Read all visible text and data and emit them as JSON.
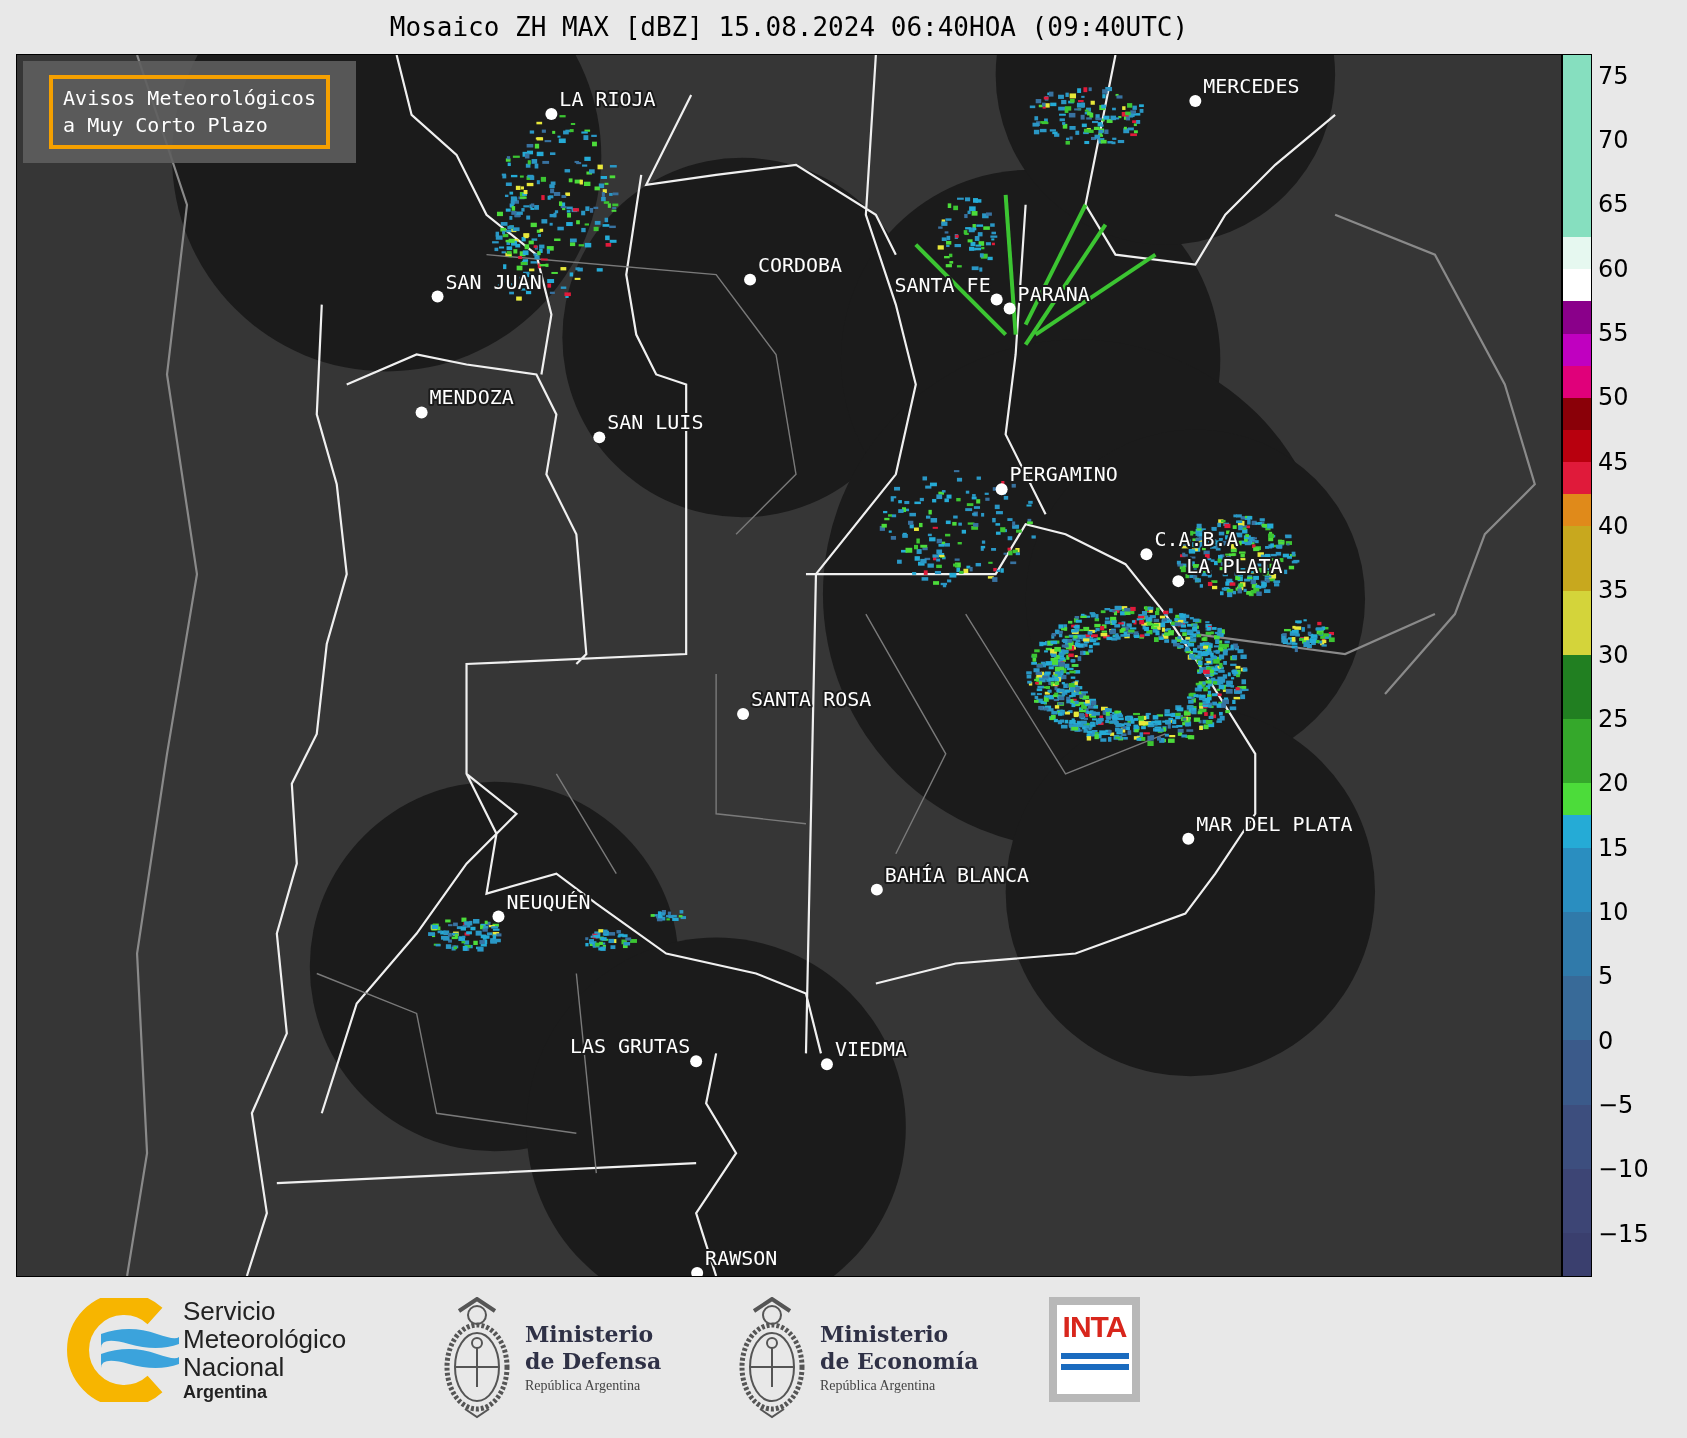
{
  "title": "Mosaico ZH MAX [dBZ] 15.08.2024 06:40HOA (09:40UTC)",
  "notice": [
    "Avisos Meteorológicos",
    "a Muy Corto Plazo"
  ],
  "cities": [
    {
      "name": "LA RIOJA"
    },
    {
      "name": "MERCEDES"
    },
    {
      "name": "SAN JUAN"
    },
    {
      "name": "CORDOBA"
    },
    {
      "name": "SANTA FE"
    },
    {
      "name": "PARANA"
    },
    {
      "name": "MENDOZA"
    },
    {
      "name": "SAN LUIS"
    },
    {
      "name": "PERGAMINO"
    },
    {
      "name": "C.A.B.A"
    },
    {
      "name": "LA PLATA"
    },
    {
      "name": "SANTA ROSA"
    },
    {
      "name": "MAR DEL PLATA"
    },
    {
      "name": "BAHÍA BLANCA"
    },
    {
      "name": "NEUQUÉN"
    },
    {
      "name": "LAS GRUTAS"
    },
    {
      "name": "VIEDMA"
    },
    {
      "name": "RAWSON"
    }
  ],
  "colorbar": {
    "ticks": [
      "75",
      "70",
      "65",
      "60",
      "55",
      "50",
      "45",
      "40",
      "35",
      "30",
      "25",
      "20",
      "15",
      "10",
      "5",
      "0",
      "−5",
      "−10",
      "−15"
    ]
  },
  "logos": [
    {
      "kind": "smn",
      "lines": [
        "Servicio",
        "Meteorológico",
        "Nacional"
      ],
      "subtitle": "Argentina"
    },
    {
      "kind": "ministry",
      "lines": [
        "Ministerio",
        "de Defensa"
      ],
      "subtitle": "República Argentina"
    },
    {
      "kind": "ministry",
      "lines": [
        "Ministerio",
        "de Economía"
      ],
      "subtitle": "República Argentina"
    },
    {
      "kind": "inta",
      "lines": [
        "INTA"
      ]
    }
  ]
}
